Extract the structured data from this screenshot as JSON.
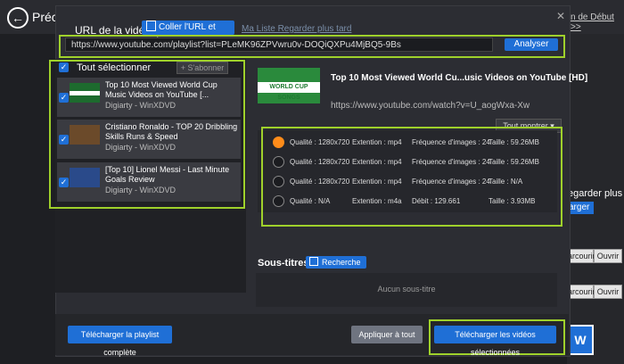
{
  "background": {
    "back_label": "Précé",
    "help_link": "n de Début >>",
    "download_title": "egarder plus ta",
    "blue_btn": "arger",
    "parcourir_1": "arcourir",
    "ouvrir_1": "Ouvrir",
    "parcourir_2": "arcourir",
    "ouvrir_2": "Ouvrir"
  },
  "dialog": {
    "url_label": "URL de la vidéo :",
    "paste_btn": "Coller l'URL et analyser",
    "later_link": "Ma Liste Regarder plus tard",
    "url_value": "https://www.youtube.com/playlist?list=PLeMK96ZPVwru0v-DOQiQXPu4MjBQ5-9Bs",
    "analyse_btn": "Analyser"
  },
  "playlist": {
    "select_all": "Tout sélectionner",
    "subscribe_btn": "+ S'abonner",
    "items": [
      {
        "title": "Top 10 Most Viewed World Cup Music Videos on YouTube [...",
        "channel": "Digiarty - WinXDVD"
      },
      {
        "title": "Cristiano Ronaldo - TOP 20 Dribbling Skills Runs & Speed",
        "channel": "Digiarty - WinXDVD"
      },
      {
        "title": "[Top 10] Lionel Messi - Last Minute Goals Review",
        "channel": "Digiarty - WinXDVD"
      }
    ]
  },
  "detail": {
    "thumb_text": "WORLD CUP SONGS",
    "title": "Top 10 Most Viewed World Cu...usic Videos on YouTube [HD]",
    "url": "https://www.youtube.com/watch?v=U_aogWxa-Xw",
    "show_all": "Tout montrer",
    "formats": [
      {
        "quality": "Qualité : 1280x720",
        "ext": "Extention : mp4",
        "rate": "Fréquence d'images : 24",
        "size": "Taille : 59.26MB",
        "selected": true
      },
      {
        "quality": "Qualité : 1280x720",
        "ext": "Extention : mp4",
        "rate": "Fréquence d'images : 24",
        "size": "Taille : 59.26MB",
        "selected": false
      },
      {
        "quality": "Qualité : 1280x720",
        "ext": "Extention : mp4",
        "rate": "Fréquence d'images : 24",
        "size": "Taille : N/A",
        "selected": false
      },
      {
        "quality": "Qualité : N/A",
        "ext": "Extention : m4a",
        "rate": "Débit : 129.661",
        "size": "Taille : 3.93MB",
        "selected": false
      }
    ],
    "subtitles_label": "Sous-titres",
    "search_btn": "Recherche",
    "no_subtitles": "Aucun sous-titre"
  },
  "footer": {
    "download_playlist": "Télécharger la playlist complète",
    "apply_all": "Appliquer à tout",
    "download_selected": "Télécharger les vidéos sélectionnées"
  }
}
